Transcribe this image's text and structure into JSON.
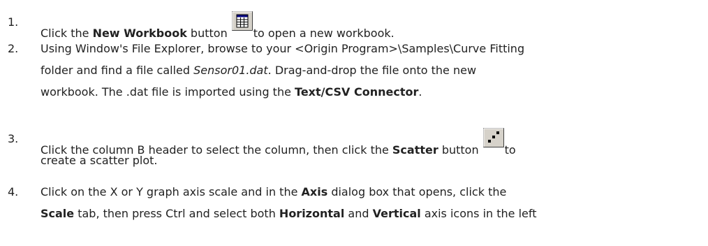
{
  "steps": [
    {
      "number": "1.",
      "lines": [
        {
          "parts": [
            {
              "t": "Click the "
            },
            {
              "t": "New Workbook",
              "b": true
            },
            {
              "t": " button"
            },
            {
              "icon": "new-workbook-icon"
            },
            {
              "t": "to open a new workbook."
            }
          ]
        }
      ]
    },
    {
      "number": "2.",
      "lines": [
        {
          "parts": [
            {
              "t": "Using Window's File Explorer, browse to your <Origin Program>\\Samples\\Curve Fitting"
            }
          ]
        },
        {
          "parts": [
            {
              "t": "folder and find a file called "
            },
            {
              "t": "Sensor01.dat",
              "i": true
            },
            {
              "t": ". Drag-and-drop the file onto the new"
            }
          ]
        },
        {
          "parts": [
            {
              "t": "workbook. The .dat file is imported using the "
            },
            {
              "t": "Text/CSV Connector",
              "b": true
            },
            {
              "t": "."
            }
          ]
        }
      ]
    },
    {
      "number": "3.",
      "lines": [
        {
          "parts": [
            {
              "t": "Click the column B header to select the column, then click the "
            },
            {
              "t": "Scatter",
              "b": true
            },
            {
              "t": " button"
            },
            {
              "icon": "scatter-plot-icon"
            },
            {
              "t": "to"
            }
          ]
        },
        {
          "parts": [
            {
              "t": "create a scatter plot."
            }
          ]
        }
      ]
    },
    {
      "number": "4.",
      "lines": [
        {
          "parts": [
            {
              "t": "Click on the X or Y graph axis scale and in the "
            },
            {
              "t": "Axis",
              "b": true
            },
            {
              "t": " dialog box that opens, click the"
            }
          ]
        },
        {
          "parts": [
            {
              "t": "Scale",
              "b": true
            },
            {
              "t": " tab, then press Ctrl and select both "
            },
            {
              "t": "Horizontal",
              "b": true
            },
            {
              "t": " and "
            },
            {
              "t": "Vertical",
              "b": true
            },
            {
              "t": " axis icons in the left"
            }
          ]
        }
      ]
    }
  ]
}
